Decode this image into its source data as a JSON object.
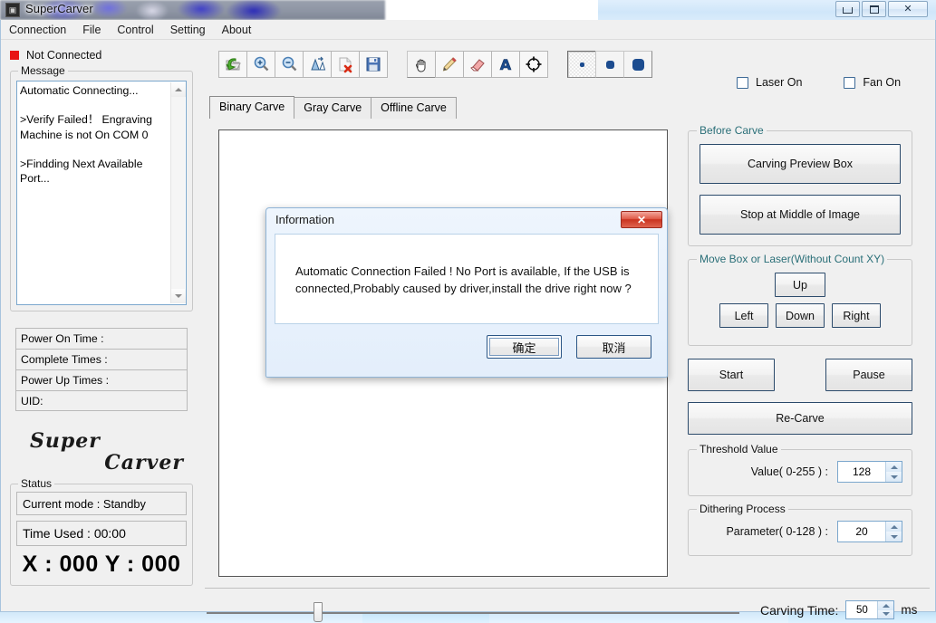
{
  "window": {
    "title": "SuperCarver",
    "icon": "app-icon",
    "controls": {
      "minimize": "minimize-icon",
      "maximize": "maximize-icon",
      "close": "✕"
    }
  },
  "menu": {
    "items": [
      "Connection",
      "File",
      "Control",
      "Setting",
      "About"
    ]
  },
  "left": {
    "connection_status": "Not Connected",
    "connection_color": "#e81414",
    "message_legend": "Message",
    "message_text": "Automatic Connecting...\n\n>Verify Failed！ Engraving Machine is not On COM 0\n\n>Findding Next Available Port...",
    "info_rows": [
      "Power On Time :",
      "Complete Times :",
      "Power Up Times :",
      "UID:"
    ],
    "brand_line1": "Super",
    "brand_line2": "Carver",
    "status_legend": "Status",
    "current_mode": "Current mode : Standby",
    "time_used": "Time Used :  00:00",
    "xy_readout": "X : 000  Y : 000"
  },
  "toolbar": {
    "groups": [
      [
        {
          "name": "open-file-icon",
          "glyph": "open"
        },
        {
          "name": "zoom-in-icon",
          "glyph": "zoomin"
        },
        {
          "name": "zoom-out-icon",
          "glyph": "zoomout"
        },
        {
          "name": "scale-image-icon",
          "glyph": "scale"
        },
        {
          "name": "delete-file-icon",
          "glyph": "delete"
        },
        {
          "name": "save-icon",
          "glyph": "save"
        }
      ],
      [
        {
          "name": "pan-hand-icon",
          "glyph": "hand"
        },
        {
          "name": "pencil-icon",
          "glyph": "pencil"
        },
        {
          "name": "eraser-icon",
          "glyph": "eraser"
        },
        {
          "name": "text-tool-icon",
          "glyph": "textA"
        },
        {
          "name": "target-icon",
          "glyph": "target"
        }
      ],
      [
        {
          "name": "brush-size-small-icon",
          "glyph": "dot-small"
        },
        {
          "name": "brush-size-medium-icon",
          "glyph": "dot-medium"
        },
        {
          "name": "brush-size-large-icon",
          "glyph": "dot-large"
        }
      ]
    ],
    "brush_color": "#1c4c8f"
  },
  "checkboxes": [
    {
      "label": "Laser On",
      "checked": false
    },
    {
      "label": "Fan On",
      "checked": false
    }
  ],
  "tabs": [
    {
      "label": "Binary Carve",
      "active": true
    },
    {
      "label": "Gray Carve",
      "active": false
    },
    {
      "label": "Offline Carve",
      "active": false
    }
  ],
  "right": {
    "before_carve": {
      "legend": "Before Carve",
      "buttons": [
        "Carving Preview Box",
        "Stop at Middle of Image"
      ]
    },
    "move_group": {
      "legend": "Move Box or Laser(Without Count XY)",
      "up": "Up",
      "left": "Left",
      "down": "Down",
      "right": "Right"
    },
    "actions": {
      "start": "Start",
      "pause": "Pause",
      "recarve": "Re-Carve"
    },
    "threshold": {
      "legend": "Threshold Value",
      "label": "Value( 0-255 ) :",
      "value": "128"
    },
    "dithering": {
      "legend": "Dithering Process",
      "label": "Parameter( 0-128 ) :",
      "value": "20"
    }
  },
  "bottom": {
    "carving_time_label": "Carving Time:",
    "carving_time_value": "50",
    "carving_time_unit": "ms",
    "slider_position_percent": 20
  },
  "dialog": {
    "title": "Information",
    "close_glyph": "✕",
    "message": "Automatic Connection Failed ! No Port is available, If the USB is connected,Probably caused by driver,install the drive right now ?",
    "ok_label": "确定",
    "cancel_label": "取消"
  }
}
